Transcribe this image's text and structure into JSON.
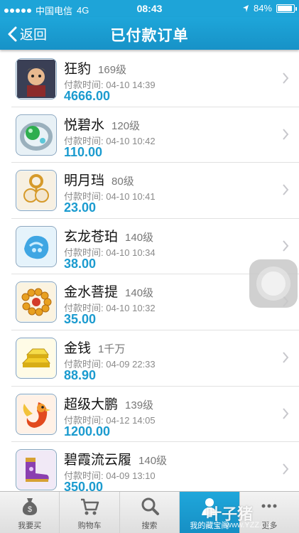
{
  "status_bar": {
    "carrier": "中国电信",
    "network": "4G",
    "time": "08:43",
    "battery": "84%"
  },
  "nav": {
    "back_label": "返回",
    "title": "已付款订单"
  },
  "orders": [
    {
      "name": "狂豹",
      "level": "169级",
      "paid_time": "付款时间: 04-10 14:39",
      "price": "4666.00",
      "icon": "warrior-avatar-icon"
    },
    {
      "name": "悦碧水",
      "level": "120级",
      "paid_time": "付款时间: 04-10 10:42",
      "price": "110.00",
      "icon": "jade-pendant-icon"
    },
    {
      "name": "明月珰",
      "level": "80级",
      "paid_time": "付款时间: 04-10 10:41",
      "price": "23.00",
      "icon": "pearl-earring-icon"
    },
    {
      "name": "玄龙苍珀",
      "level": "140级",
      "paid_time": "付款时间: 04-10 10:34",
      "price": "38.00",
      "icon": "blue-dragon-amber-icon"
    },
    {
      "name": "金水菩提",
      "level": "140级",
      "paid_time": "付款时间: 04-10 10:32",
      "price": "35.00",
      "icon": "gold-bead-bracelet-icon"
    },
    {
      "name": "金钱",
      "level": "1千万",
      "paid_time": "付款时间: 04-09 22:33",
      "price": "88.90",
      "icon": "gold-bars-icon"
    },
    {
      "name": "超级大鹏",
      "level": "139级",
      "paid_time": "付款时间: 04-12 14:05",
      "price": "1200.00",
      "icon": "phoenix-bird-icon"
    },
    {
      "name": "碧霞流云履",
      "level": "140级",
      "paid_time": "付款时间: 04-09 13:10",
      "price": "350.00",
      "icon": "purple-boots-icon"
    }
  ],
  "tabs": [
    {
      "label": "我要买",
      "icon": "money-bag-icon",
      "active": false
    },
    {
      "label": "购物车",
      "icon": "shopping-cart-icon",
      "active": false
    },
    {
      "label": "搜索",
      "icon": "search-icon",
      "active": false
    },
    {
      "label": "我的藏宝阁",
      "icon": "person-icon",
      "active": true
    },
    {
      "label": "更多",
      "icon": "more-icon",
      "active": false
    }
  ],
  "watermark": {
    "text": "叶子猪",
    "url": "www.YZZ.cN"
  },
  "colors": {
    "accent": "#1ea4d8",
    "price": "#1b9bcf"
  }
}
